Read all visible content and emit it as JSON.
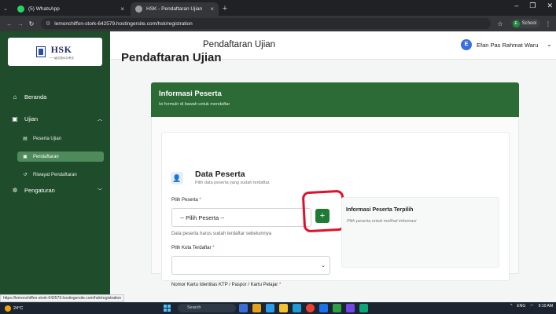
{
  "browser": {
    "tabs": [
      {
        "title": "(5) WhatsApp",
        "active": false,
        "color": "#25d366"
      },
      {
        "title": "HSK - Pendaftaran Ujian",
        "active": true,
        "color": "#9aa0a6"
      }
    ],
    "url": "lemonchiffon-stork-642579.hostingersite.com/hsk/registration",
    "profile": {
      "initial": "E",
      "label": "School"
    },
    "status_url": "https://lemonchiffon-stork-642579.hostingersite.com/hsk/registration"
  },
  "sidebar": {
    "logo": {
      "big": "HSK",
      "small": "一一级汉语水平考试"
    },
    "items": [
      {
        "label": "Beranda"
      },
      {
        "label": "Ujian"
      },
      {
        "label": "Pengaturan"
      }
    ],
    "sub_items": [
      {
        "label": "Peserta Ujian"
      },
      {
        "label": "Pendaftaran"
      },
      {
        "label": "Riwayat Pendaftaran"
      }
    ]
  },
  "topbar": {
    "title": "Pendaftaran Ujian",
    "user_initial": "E",
    "user_name": "Efan Pas Rahmat Waru"
  },
  "main": {
    "heading": "Pendaftaran Ujian",
    "card": {
      "title": "Informasi Peserta",
      "subtitle": "Isi formulir di bawah untuk mendaftar"
    },
    "section": {
      "title": "Data Peserta",
      "subtitle": "Pilih data peserta yang sudah terdaftar."
    },
    "fields": {
      "peserta_label": "Pilih Peserta",
      "peserta_value": "-- Pilih Peserta --",
      "peserta_hint": "Data peserta harus sudah terdaftar sebelumnya",
      "kota_label": "Pilih Kota Terdaftar",
      "kota_value": "",
      "ktp_label": "Nomor Kartu Identitas KTP / Paspor / Kartu Pelajar",
      "required_mark": "*"
    },
    "add_button": "+",
    "info_panel": {
      "title": "Informasi Peserta Terpilih",
      "subtitle": "Pilih peserta untuk melihat informasi"
    }
  },
  "taskbar": {
    "weather": "24°C",
    "search": "Search",
    "tray": {
      "lang": "ENG",
      "time": "9:10 AM"
    }
  }
}
